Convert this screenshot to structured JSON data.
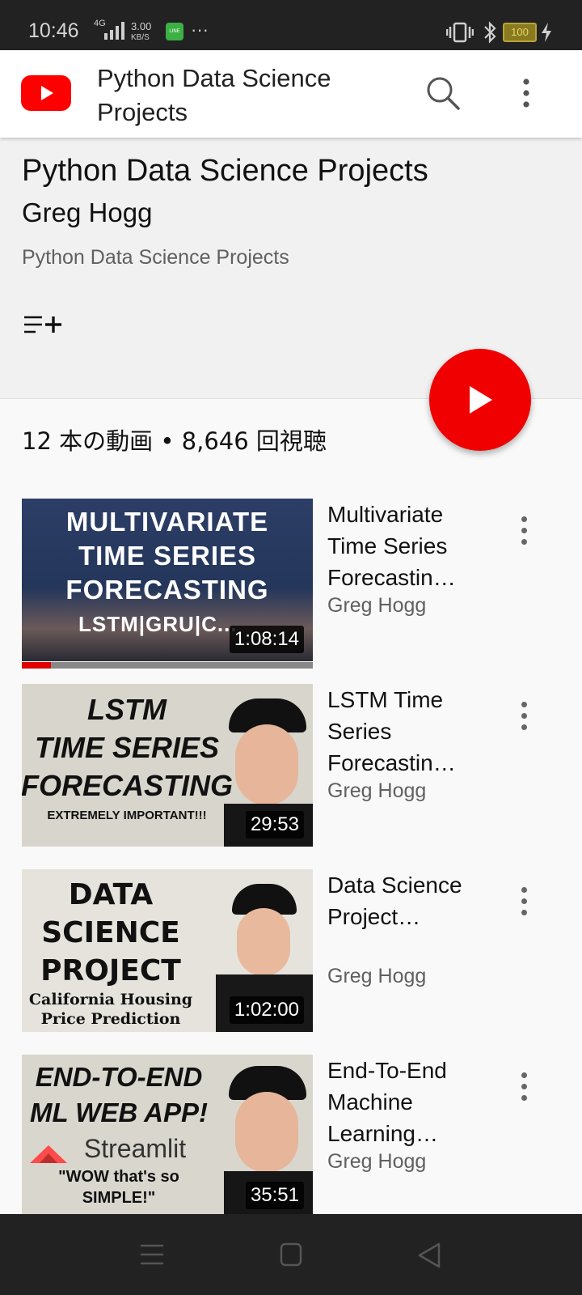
{
  "status": {
    "time": "10:46",
    "network": "4G",
    "speed_value": "3.00",
    "speed_unit": "KB/S",
    "line_app": "LINE",
    "more": "···",
    "battery": "100"
  },
  "app_bar": {
    "title": "Python Data Science Projects"
  },
  "playlist": {
    "title": "Python Data Science Projects",
    "owner": "Greg Hogg",
    "description": "Python Data Science Projects",
    "stats": "12 本の動画 • 8,646 回視聴"
  },
  "videos": [
    {
      "title": "Multivariate Time Series Forecastin…",
      "channel": "Greg Hogg",
      "duration": "1:08:14",
      "thumb_lines": [
        "MULTIVARIATE",
        "TIME SERIES",
        "FORECASTING",
        "LSTM|GRU|C..."
      ],
      "progress": 0.1
    },
    {
      "title": "LSTM Time Series Forecastin…",
      "channel": "Greg Hogg",
      "duration": "29:53",
      "thumb_lines": [
        "LSTM",
        "TIME SERIES",
        "FORECASTING",
        "EXTREMELY IMPORTANT!!!"
      ]
    },
    {
      "title": "Data Science Project…",
      "channel": "Greg Hogg",
      "duration": "1:02:00",
      "thumb_lines": [
        "DATA",
        "SCIENCE",
        "PROJECT",
        "California Housing",
        "Price Prediction"
      ]
    },
    {
      "title": "End-To-End Machine Learning…",
      "channel": "Greg Hogg",
      "duration": "35:51",
      "thumb_lines": [
        "END-TO-END",
        "ML WEB APP!",
        "Streamlit",
        "\"WOW that's so",
        "SIMPLE!\""
      ]
    }
  ],
  "colors": {
    "brand_red": "#ff0000",
    "fab_red": "#f00000",
    "status_bg": "#222222"
  },
  "icons": [
    "youtube-logo-icon",
    "search-icon",
    "more-vertical-icon",
    "add-to-queue-icon",
    "play-icon",
    "menu-icon",
    "home-square-icon",
    "back-triangle-icon"
  ]
}
